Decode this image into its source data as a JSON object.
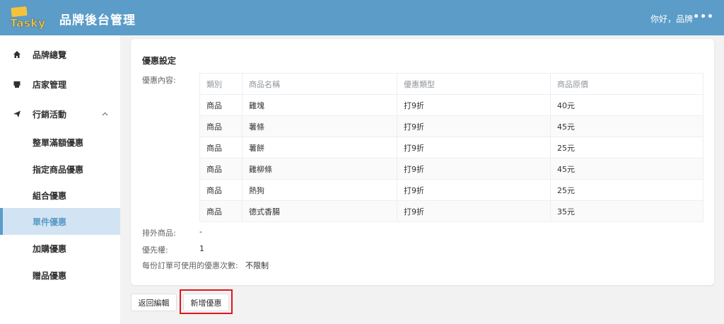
{
  "header": {
    "logo_text": "Tasky",
    "title": "品牌後台管理",
    "greeting": "你好，品牌",
    "more_icon": "ellipsis-icon",
    "background": "#5b9cc8"
  },
  "sidebar": {
    "items": [
      {
        "label": "品牌總覽",
        "icon": "home-icon"
      },
      {
        "label": "店家管理",
        "icon": "store-icon"
      },
      {
        "label": "行銷活動",
        "icon": "paper-plane-icon",
        "expanded": true
      }
    ],
    "sub_items": [
      {
        "label": "整單滿額優惠"
      },
      {
        "label": "指定商品優惠"
      },
      {
        "label": "組合優惠"
      },
      {
        "label": "單件優惠",
        "active": true
      },
      {
        "label": "加購優惠"
      },
      {
        "label": "贈品優惠"
      }
    ],
    "active_color": "#5b9cc8"
  },
  "promo": {
    "title": "優惠設定",
    "content_label": "優惠內容:",
    "table": {
      "headers": [
        "類別",
        "商品名稱",
        "優惠類型",
        "商品原價"
      ],
      "rows": [
        [
          "商品",
          "雞塊",
          "打9折",
          "40元"
        ],
        [
          "商品",
          "薯條",
          "打9折",
          "45元"
        ],
        [
          "商品",
          "薯餅",
          "打9折",
          "25元"
        ],
        [
          "商品",
          "雞柳條",
          "打9折",
          "45元"
        ],
        [
          "商品",
          "熱狗",
          "打9折",
          "25元"
        ],
        [
          "商品",
          "德式香腸",
          "打9折",
          "35元"
        ]
      ]
    },
    "excluded_label": "排外商品:",
    "excluded_value": "-",
    "priority_label": "優先權:",
    "priority_value": "1",
    "usage_label": "每份訂單可使用的優惠次數:",
    "usage_value": "不限制"
  },
  "actions": {
    "back_label": "返回編輯",
    "add_label": "新增優惠",
    "highlight_color": "#e0161c"
  }
}
